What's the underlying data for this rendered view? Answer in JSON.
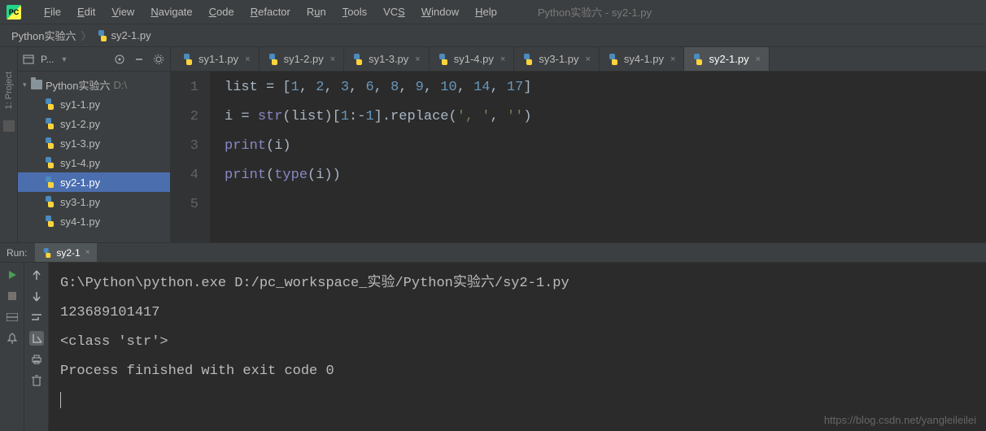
{
  "window_title": "Python实验六 - sy2-1.py",
  "menu": [
    "File",
    "Edit",
    "View",
    "Navigate",
    "Code",
    "Refactor",
    "Run",
    "Tools",
    "VCS",
    "Window",
    "Help"
  ],
  "breadcrumb": {
    "root": "Python实验六",
    "file": "sy2-1.py"
  },
  "project": {
    "toolbar_label": "P...",
    "root": "Python实验六",
    "root_suffix": "D:\\",
    "files": [
      "sy1-1.py",
      "sy1-2.py",
      "sy1-3.py",
      "sy1-4.py",
      "sy2-1.py",
      "sy3-1.py",
      "sy4-1.py"
    ],
    "selected": "sy2-1.py"
  },
  "vertical_tab": "1: Project",
  "tabs": [
    "sy1-1.py",
    "sy1-2.py",
    "sy1-3.py",
    "sy1-4.py",
    "sy3-1.py",
    "sy4-1.py",
    "sy2-1.py"
  ],
  "active_tab": "sy2-1.py",
  "code": {
    "lines": [
      "1",
      "2",
      "3",
      "4",
      "5"
    ],
    "l1_list": "list",
    "l1_eq": " = [",
    "l1_nums": [
      "1",
      "2",
      "3",
      "6",
      "8",
      "9",
      "10",
      "14",
      "17"
    ],
    "l1_close": "]",
    "l2_i": "i = ",
    "l2_str": "str",
    "l2_mid": "(list)[",
    "l2_n1": "1",
    "l2_colon": ":-",
    "l2_n2": "1",
    "l2_rep": "].replace(",
    "l2_s1": "', '",
    "l2_comma": ", ",
    "l2_s2": "''",
    "l2_close": ")",
    "l3_print": "print",
    "l3_arg": "(i)",
    "l4_print": "print",
    "l4_open": "(",
    "l4_type": "type",
    "l4_arg": "(i))"
  },
  "run": {
    "label": "Run:",
    "tab": "sy2-1",
    "output": [
      "G:\\Python\\python.exe D:/pc_workspace_实验/Python实验六/sy2-1.py",
      "123689101417",
      "<class 'str'>",
      "",
      "Process finished with exit code 0"
    ]
  },
  "watermark": "https://blog.csdn.net/yangleileilei"
}
